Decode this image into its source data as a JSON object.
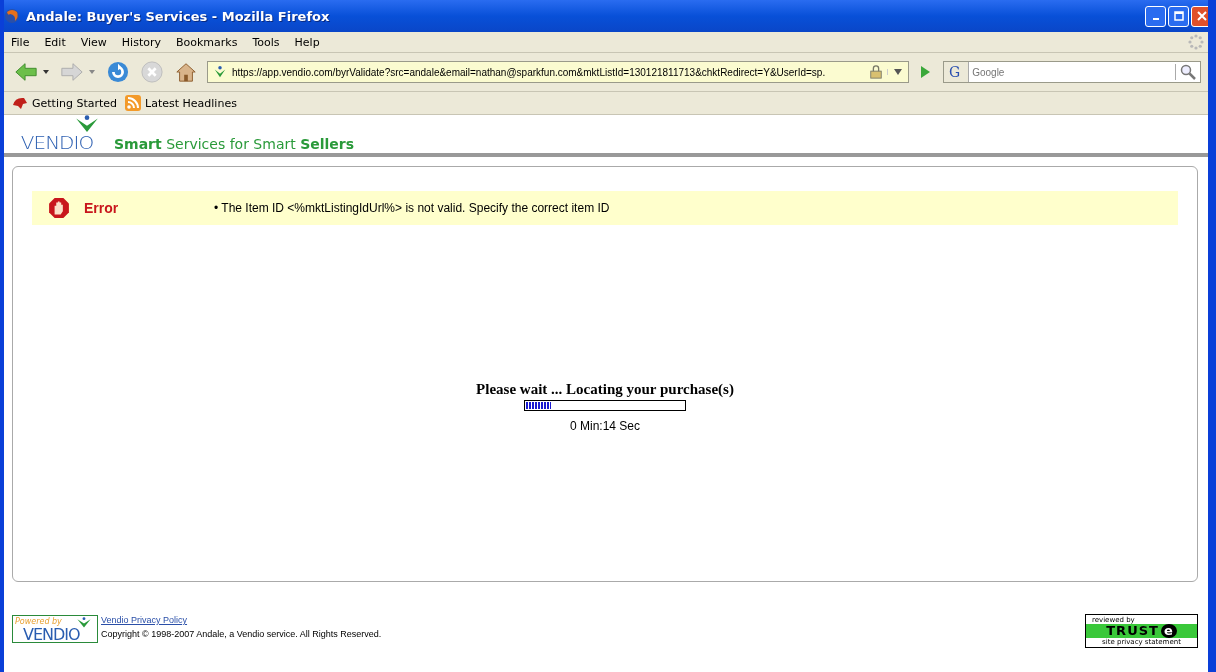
{
  "window": {
    "title": "Andale: Buyer's Services - Mozilla Firefox"
  },
  "menu": [
    "File",
    "Edit",
    "View",
    "History",
    "Bookmarks",
    "Tools",
    "Help"
  ],
  "address_bar": {
    "value": "https://app.vendio.com/byrValidate?src=andale&email=nathan@sparkfun.com&mktListId=130121811713&chktRedirect=Y&UserId=sp."
  },
  "search": {
    "engine_letter": "G",
    "placeholder": "Google"
  },
  "bookmarks": [
    {
      "label": "Getting Started",
      "kind": "page"
    },
    {
      "label": "Latest Headlines",
      "kind": "feed"
    }
  ],
  "header": {
    "logo": "VENDIO",
    "tagline": "**Smart** Services for Smart **Sellers**"
  },
  "error": {
    "label": "Error",
    "message": "• The Item ID <%mktListingIdUrl%> is not valid. Specify the correct item ID"
  },
  "progress": {
    "title": "Please wait ... Locating your purchase(s)",
    "level": 0.16,
    "time": "0 Min:14 Sec"
  },
  "footer": {
    "powered_by": "Powered by",
    "powered_logo": "VENDIO",
    "privacy_link": "Vendio Privacy Policy",
    "copyright": "Copyright © 1998-2007 Andale, a Vendio service. All Rights Reserved.",
    "seal_top": "reviewed by",
    "seal_brand": "TRUST",
    "seal_mark": "e",
    "seal_bottom": "site privacy statement"
  }
}
